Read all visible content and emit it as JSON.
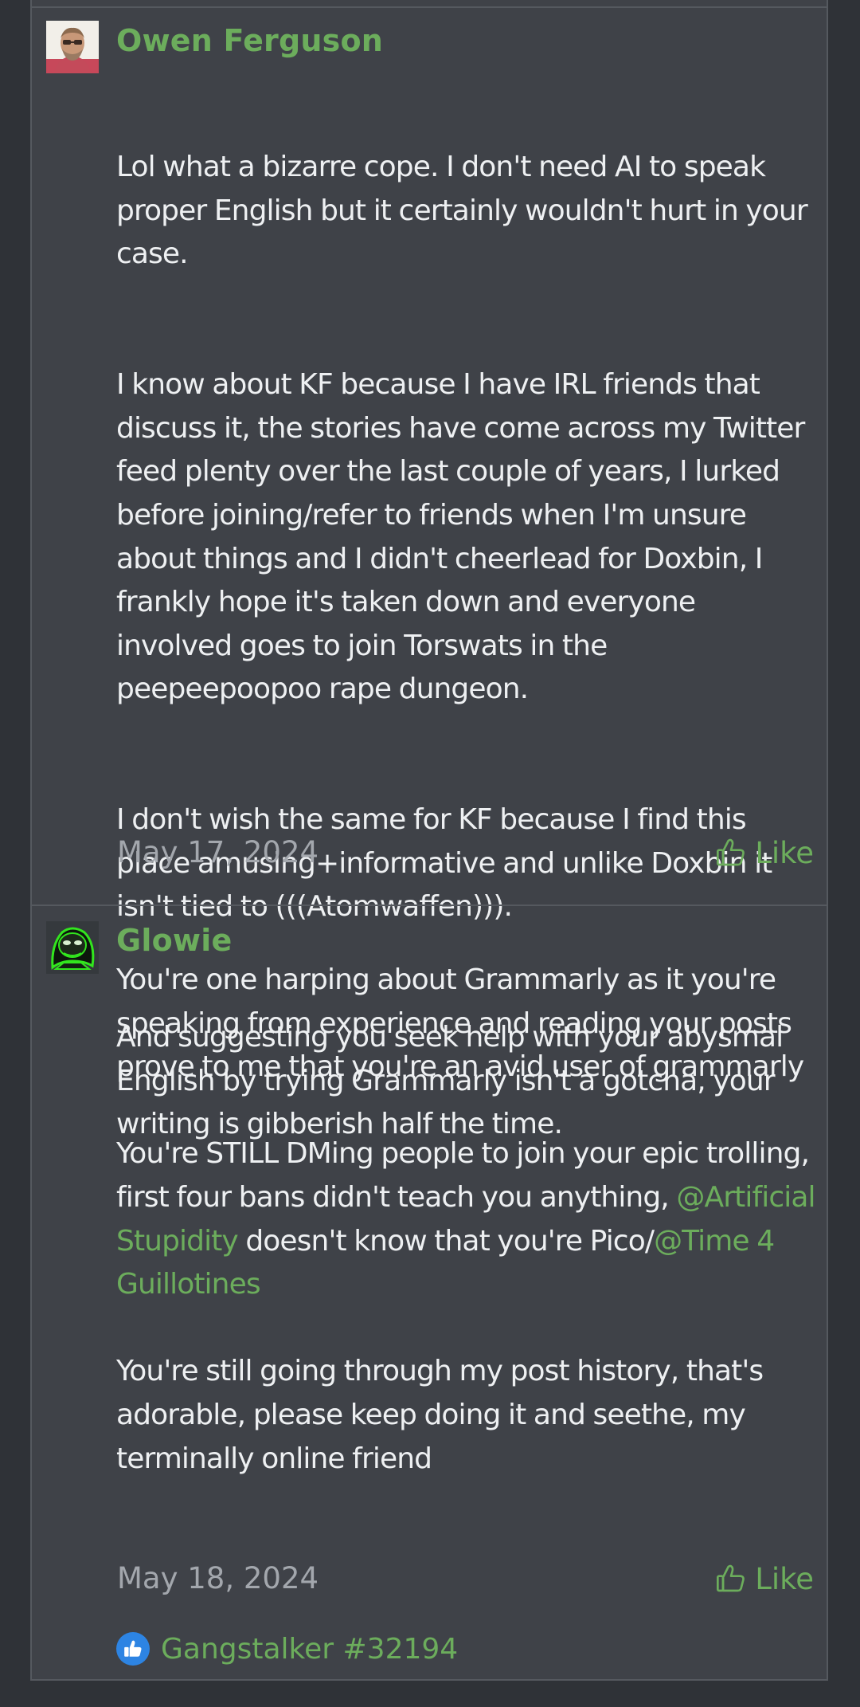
{
  "posts": [
    {
      "username": "Owen Ferguson",
      "paragraphs": [
        "Lol what a bizarre cope. I don't need AI to speak proper English but it certainly wouldn't hurt in your case.",
        "I know about KF because I have IRL friends that discuss it, the stories have come across my Twitter feed plenty over the last couple of years, I lurked before joining/refer to friends when I'm unsure about things and I didn't cheerlead for Doxbin, I frankly hope it's taken down and everyone involved goes to join Torswats in the peepeepoopoo rape dungeon.",
        "I don't wish the same for KF because I find this place amusing+informative and unlike Doxbin it isn't tied to (((Atomwaffen))).",
        "And suggesting you seek help with your abysmal English by trying Grammarly isn't a gotcha, your writing is gibberish half the time."
      ],
      "date": "May 17, 2024",
      "like_label": "Like"
    },
    {
      "username": "Glowie",
      "para1": "You're one harping about Grammarly as it you're speaking from experience and reading your posts prove to me that you're an avid user of grammarly",
      "para2_a": "You're STILL DMing people to join your epic trolling, first four bans didn't teach you anything, ",
      "mention1": "@Artificial Stupidity",
      "para2_b": " doesn't know that you're Pico/",
      "mention2": "@Time 4 Guillotines",
      "para3": "You're still going through my post history, that's adorable, please keep doing it and seethe, my terminally online friend",
      "date": "May 18, 2024",
      "like_label": "Like",
      "reaction_users": "Gangstalker #32194"
    }
  ],
  "icons": {
    "like": "thumbs-up-outline-icon",
    "reaction": "thumbs-up-reaction-icon"
  },
  "colors": {
    "accent_green": "#6cad5c",
    "post_background": "#3f4248",
    "page_background": "#2f3237",
    "reaction_blue": "#2d84e3"
  }
}
